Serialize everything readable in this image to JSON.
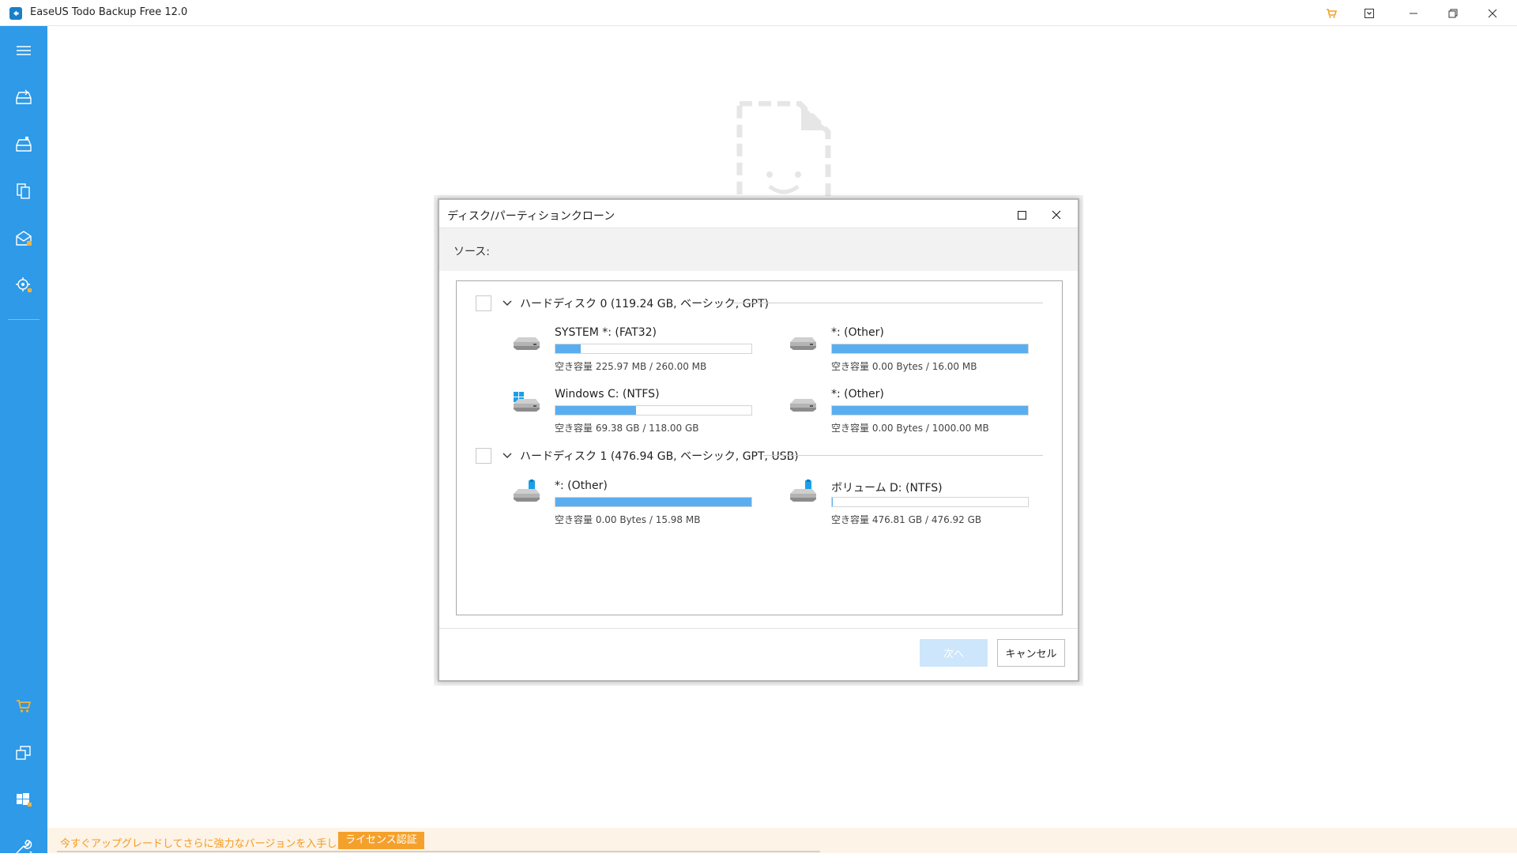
{
  "window": {
    "title": "EaseUS Todo Backup Free 12.0",
    "accent": "#2e9ae8"
  },
  "titlebar_icons": [
    "cart-icon",
    "dropdown-box-icon",
    "minimize-icon",
    "restore-icon",
    "close-icon"
  ],
  "sidebar": {
    "items": [
      {
        "name": "menu-icon"
      },
      {
        "name": "disk-backup-icon"
      },
      {
        "name": "system-backup-icon"
      },
      {
        "name": "file-backup-icon"
      },
      {
        "name": "mail-backup-icon"
      },
      {
        "name": "smart-backup-icon"
      },
      {
        "name": "cart-icon"
      },
      {
        "name": "clone-icon"
      },
      {
        "name": "windows-tools-icon"
      },
      {
        "name": "tools-icon"
      }
    ]
  },
  "notice": {
    "text": "今すぐアップグレードしてさらに強力なバージョンを入手しましょう。",
    "button": "ライセンス認証"
  },
  "dialog": {
    "title": "ディスク/パーティションクローン",
    "source_label": "ソース:",
    "next_button": "次へ",
    "cancel_button": "キャンセル",
    "disks": [
      {
        "label": "ハードディスク 0 (119.24 GB, ベーシック, GPT)",
        "partitions": [
          {
            "name": "SYSTEM *: (FAT32)",
            "capacity": "空き容量 225.97 MB / 260.00 MB",
            "used_fraction": 0.13,
            "icon": "hdd-icon"
          },
          {
            "name": "*: (Other)",
            "capacity": "空き容量 0.00 Bytes / 16.00 MB",
            "used_fraction": 1.0,
            "icon": "hdd-icon"
          },
          {
            "name": "Windows C: (NTFS)",
            "capacity": "空き容量 69.38 GB / 118.00 GB",
            "used_fraction": 0.41,
            "icon": "windows-drive-icon"
          },
          {
            "name": "*: (Other)",
            "capacity": "空き容量 0.00 Bytes / 1000.00 MB",
            "used_fraction": 1.0,
            "icon": "hdd-icon"
          }
        ]
      },
      {
        "label": "ハードディスク 1 (476.94 GB, ベーシック, GPT, USB)",
        "partitions": [
          {
            "name": "*: (Other)",
            "capacity": "空き容量 0.00 Bytes / 15.98 MB",
            "used_fraction": 1.0,
            "icon": "usb-drive-icon"
          },
          {
            "name": "ボリューム D: (NTFS)",
            "capacity": "空き容量 476.81 GB / 476.92 GB",
            "used_fraction": 0.003,
            "icon": "usb-drive-icon"
          }
        ]
      }
    ]
  }
}
